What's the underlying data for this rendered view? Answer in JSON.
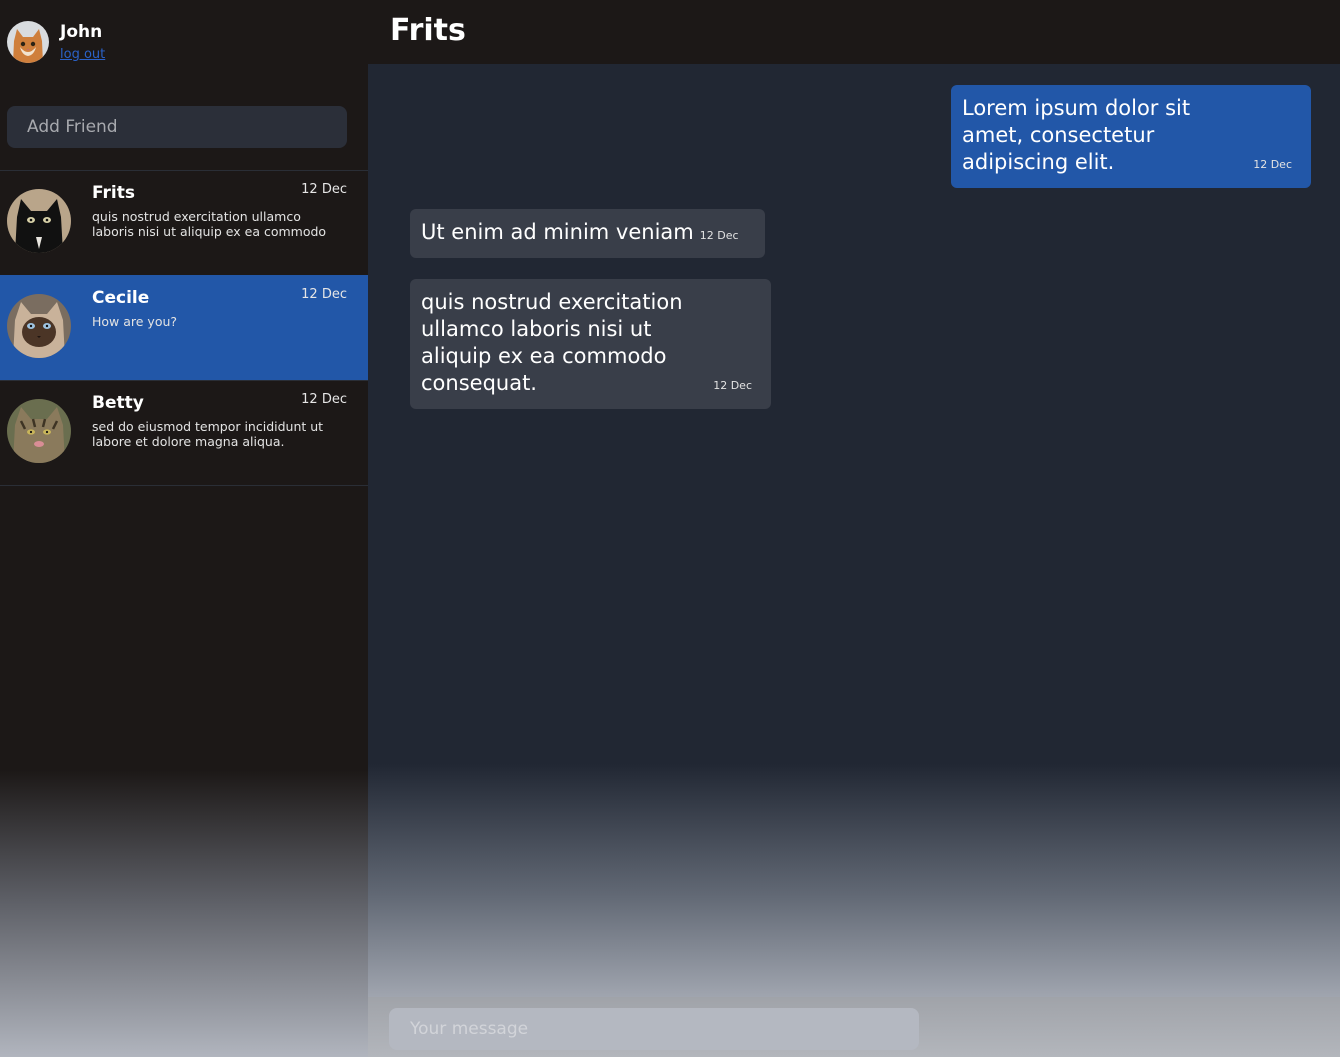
{
  "user": {
    "name": "John",
    "logout_label": "log out"
  },
  "sidebar": {
    "add_friend_placeholder": "Add Friend",
    "contacts": [
      {
        "name": "Frits",
        "date": "12 Dec",
        "preview": "quis nostrud exercitation ullamco laboris nisi ut aliquip ex ea commodo",
        "active": false,
        "avatar": "black-cat-avatar"
      },
      {
        "name": "Cecile",
        "date": "12 Dec",
        "preview": "How are you?",
        "active": true,
        "avatar": "siamese-cat-avatar"
      },
      {
        "name": "Betty",
        "date": "12 Dec",
        "preview": "sed do eiusmod tempor incididunt ut labore et dolore magna aliqua.",
        "active": false,
        "avatar": "tabby-cat-avatar"
      }
    ]
  },
  "chat": {
    "title": "Frits",
    "messages": [
      {
        "direction": "outgoing",
        "text": "Lorem ipsum dolor sit amet, consectetur adipiscing elit.",
        "time": "12 Dec"
      },
      {
        "direction": "incoming",
        "text": "Ut enim ad minim veniam",
        "time": "12 Dec"
      },
      {
        "direction": "incoming",
        "text": "quis nostrud exercitation ullamco laboris nisi ut aliquip ex ea commodo consequat.",
        "time": "12 Dec"
      }
    ],
    "input_placeholder": "Your message"
  },
  "colors": {
    "sidebar_bg": "#1c1817",
    "chat_bg": "#212733",
    "accent": "#2257a8",
    "incoming_bubble": "#393e49",
    "link": "#2b62c8"
  }
}
